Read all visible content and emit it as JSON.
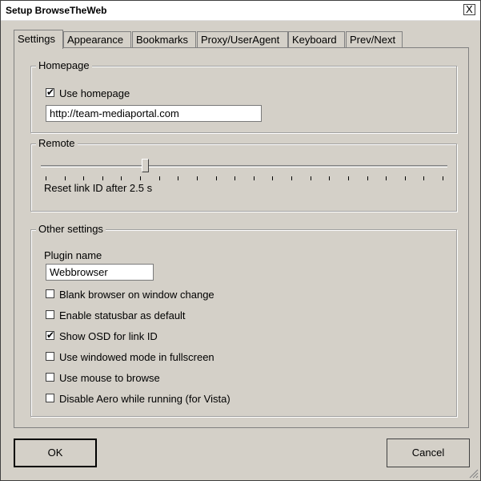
{
  "window": {
    "title": "Setup BrowseTheWeb",
    "close_label": "X"
  },
  "tabs": [
    {
      "label": "Settings",
      "active": true
    },
    {
      "label": "Appearance",
      "active": false
    },
    {
      "label": "Bookmarks",
      "active": false
    },
    {
      "label": "Proxy/UserAgent",
      "active": false
    },
    {
      "label": "Keyboard",
      "active": false
    },
    {
      "label": "Prev/Next",
      "active": false
    }
  ],
  "homepage": {
    "group_label": "Homepage",
    "use_homepage": {
      "label": "Use homepage",
      "checked": true
    },
    "url": "http://team-mediaportal.com"
  },
  "remote": {
    "group_label": "Remote",
    "slider_fraction": 0.25,
    "tick_count": 22,
    "caption": "Reset link ID after 2.5 s"
  },
  "other": {
    "group_label": "Other settings",
    "plugin_name_label": "Plugin name",
    "plugin_name_value": "Webbrowser",
    "options": [
      {
        "label": "Blank browser on window change",
        "checked": false
      },
      {
        "label": "Enable statusbar as default",
        "checked": false
      },
      {
        "label": "Show OSD for link ID",
        "checked": true
      },
      {
        "label": "Use windowed mode in fullscreen",
        "checked": false
      },
      {
        "label": "Use mouse to browse",
        "checked": false
      },
      {
        "label": "Disable Aero while running (for Vista)",
        "checked": false
      }
    ]
  },
  "buttons": {
    "ok": "OK",
    "cancel": "Cancel"
  },
  "check_mark": "✔"
}
